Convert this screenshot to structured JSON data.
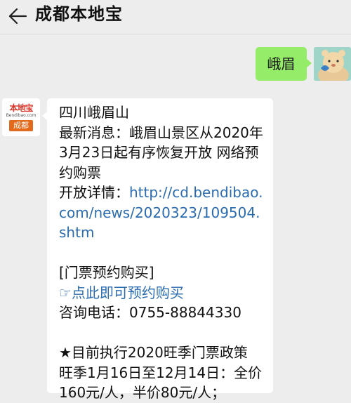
{
  "header": {
    "title": "成都本地宝",
    "back_icon": "arrow-left-icon"
  },
  "chat": {
    "user_message": "峨眉",
    "bot_avatar": {
      "brand": "本地宝",
      "sub": "Bendibao.com",
      "city": "成都"
    },
    "bot_message": {
      "title": "四川峨眉山",
      "news_label": "最新消息：",
      "news_text": "峨眉山景区从2020年3月23日起有序恢复开放 网络预约购票",
      "detail_label": "开放详情：",
      "detail_link": "http://cd.bendibao.com/news/2020323/109504.shtm",
      "ticket_header": "[门票预约购买]",
      "ticket_link_icon": "☞",
      "ticket_link": "点此即可预约购买",
      "phone_label": "咨询电话：",
      "phone": "0755-88844330",
      "policy_title": "★目前执行2020旺季门票政策",
      "policy_text": "旺季1月16日至12月14日：全价160元/人，半价80元/人；"
    }
  },
  "colors": {
    "background": "#ededed",
    "user_bubble": "#95ec69",
    "bot_bubble": "#ffffff",
    "link": "#2b6cb0",
    "brand_red": "#d7352a",
    "brand_orange": "#e26a1d"
  }
}
